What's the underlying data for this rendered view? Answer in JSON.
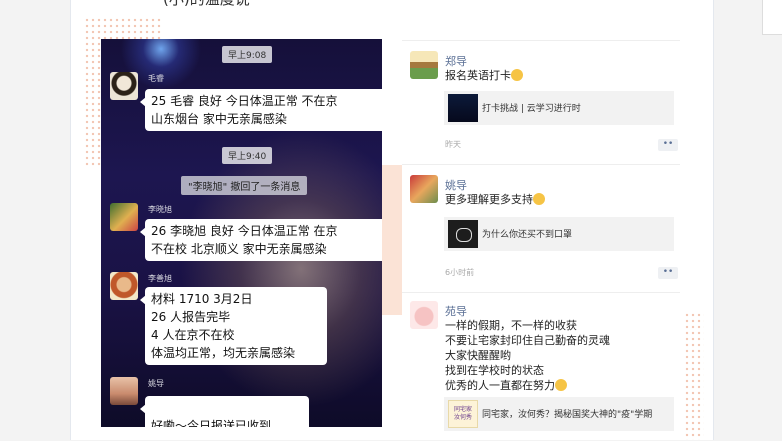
{
  "page": {
    "top_text": "(小)的温度说"
  },
  "chat": {
    "time1": "早上9:08",
    "time2": "早上9:40",
    "notice": "\"李晓旭\" 撤回了一条消息",
    "messages": [
      {
        "sender": "毛睿",
        "text": "25 毛睿 良好 今日体温正常 不在京\n山东烟台 家中无亲属感染"
      },
      {
        "sender": "李晓旭",
        "text": "26 李晓旭  良好  今日体温正常 在京\n不在校  北京顺义  家中无亲属感染"
      },
      {
        "sender": "李善旭",
        "text": "材料 1710  3月2日\n 26 人报告完毕\n4 人在京不在校\n体温均正常，均无亲属感染"
      },
      {
        "sender": "姚导",
        "text": "好嘞～今日报送已收到"
      }
    ]
  },
  "posts": [
    {
      "name": "郑导",
      "text": "报名英语打卡",
      "card": "打卡挑战 | 云学习进行时",
      "time": "昨天",
      "more": "••"
    },
    {
      "name": "姚导",
      "text": "更多理解更多支持",
      "card": "为什么你还买不到口罩",
      "time": "6小时前",
      "more": "••"
    },
    {
      "name": "苑导",
      "text": "一样的假期，不一样的收获\n不要让宅家封印住自己勤奋的灵魂\n大家快醒醒哟\n找到在学校时的状态\n优秀的人一直都在努力",
      "card": "同宅家，汝何秀？揭秘国奖大神的\"疫\"学期",
      "card_thumb": "同宅家\n汝何秀"
    }
  ],
  "colors": {
    "name_blue": "#5a6f95",
    "emoji": "#f6c445",
    "dots": "#f3c7b5"
  }
}
